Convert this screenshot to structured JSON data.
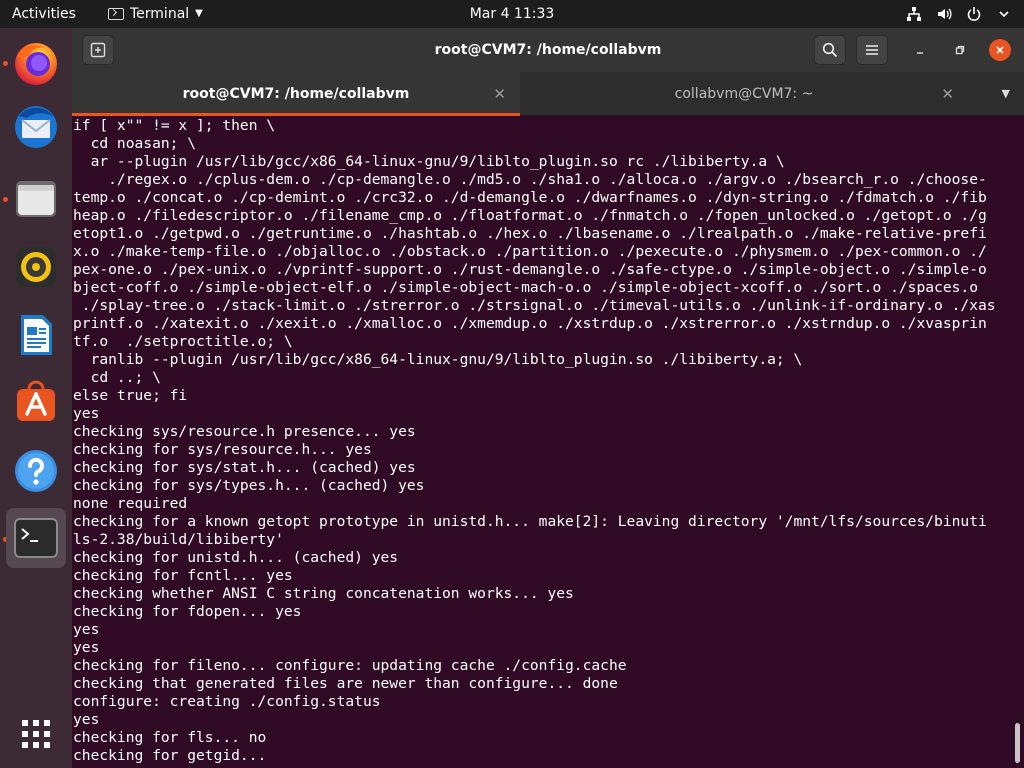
{
  "topbar": {
    "activities": "Activities",
    "app_name": "Terminal",
    "clock": "Mar 4  11:33",
    "icons": [
      "network-icon",
      "volume-icon",
      "power-icon",
      "chevron-down-icon"
    ]
  },
  "dock": {
    "apps": [
      {
        "name": "Firefox",
        "icon": "firefox-icon",
        "running": true
      },
      {
        "name": "Thunderbird",
        "icon": "thunderbird-icon",
        "running": false
      },
      {
        "name": "Files",
        "icon": "files-icon",
        "running": true
      },
      {
        "name": "Rhythmbox",
        "icon": "rhythmbox-icon",
        "running": false
      },
      {
        "name": "LibreOffice Writer",
        "icon": "writer-icon",
        "running": false
      },
      {
        "name": "Ubuntu Software",
        "icon": "software-icon",
        "running": false
      },
      {
        "name": "Help",
        "icon": "help-icon",
        "running": false
      },
      {
        "name": "Terminal",
        "icon": "terminal-icon",
        "running": true
      }
    ],
    "show_apps_icon": "grid-icon"
  },
  "window": {
    "title": "root@CVM7: /home/collabvm",
    "tabs": [
      {
        "label": "root@CVM7: /home/collabvm",
        "active": true
      },
      {
        "label": "collabvm@CVM7: ~",
        "active": false
      }
    ]
  },
  "colors": {
    "accent": "#e95420",
    "terminal_bg": "#300a24"
  },
  "terminal": {
    "lines": [
      "if [ x\"\" != x ]; then \\",
      "  cd noasan; \\",
      "  ar --plugin /usr/lib/gcc/x86_64-linux-gnu/9/liblto_plugin.so rc ./libiberty.a \\",
      "    ./regex.o ./cplus-dem.o ./cp-demangle.o ./md5.o ./sha1.o ./alloca.o ./argv.o ./bsearch_r.o ./choose-",
      "temp.o ./concat.o ./cp-demint.o ./crc32.o ./d-demangle.o ./dwarfnames.o ./dyn-string.o ./fdmatch.o ./fib",
      "heap.o ./filedescriptor.o ./filename_cmp.o ./floatformat.o ./fnmatch.o ./fopen_unlocked.o ./getopt.o ./g",
      "etopt1.o ./getpwd.o ./getruntime.o ./hashtab.o ./hex.o ./lbasename.o ./lrealpath.o ./make-relative-prefi",
      "x.o ./make-temp-file.o ./objalloc.o ./obstack.o ./partition.o ./pexecute.o ./physmem.o ./pex-common.o ./",
      "pex-one.o ./pex-unix.o ./vprintf-support.o ./rust-demangle.o ./safe-ctype.o ./simple-object.o ./simple-o",
      "bject-coff.o ./simple-object-elf.o ./simple-object-mach-o.o ./simple-object-xcoff.o ./sort.o ./spaces.o",
      " ./splay-tree.o ./stack-limit.o ./strerror.o ./strsignal.o ./timeval-utils.o ./unlink-if-ordinary.o ./xas",
      "printf.o ./xatexit.o ./xexit.o ./xmalloc.o ./xmemdup.o ./xstrdup.o ./xstrerror.o ./xstrndup.o ./xvasprin",
      "tf.o  ./setproctitle.o; \\",
      "  ranlib --plugin /usr/lib/gcc/x86_64-linux-gnu/9/liblto_plugin.so ./libiberty.a; \\",
      "  cd ..; \\",
      "else true; fi",
      "yes",
      "checking sys/resource.h presence... yes",
      "checking for sys/resource.h... yes",
      "checking for sys/stat.h... (cached) yes",
      "checking for sys/types.h... (cached) yes",
      "none required",
      "checking for a known getopt prototype in unistd.h... make[2]: Leaving directory '/mnt/lfs/sources/binuti",
      "ls-2.38/build/libiberty'",
      "checking for unistd.h... (cached) yes",
      "checking for fcntl... yes",
      "checking whether ANSI C string concatenation works... yes",
      "checking for fdopen... yes",
      "yes",
      "yes",
      "checking for fileno... configure: updating cache ./config.cache",
      "checking that generated files are newer than configure... done",
      "configure: creating ./config.status",
      "yes",
      "checking for fls... no",
      "checking for getgid..."
    ]
  }
}
